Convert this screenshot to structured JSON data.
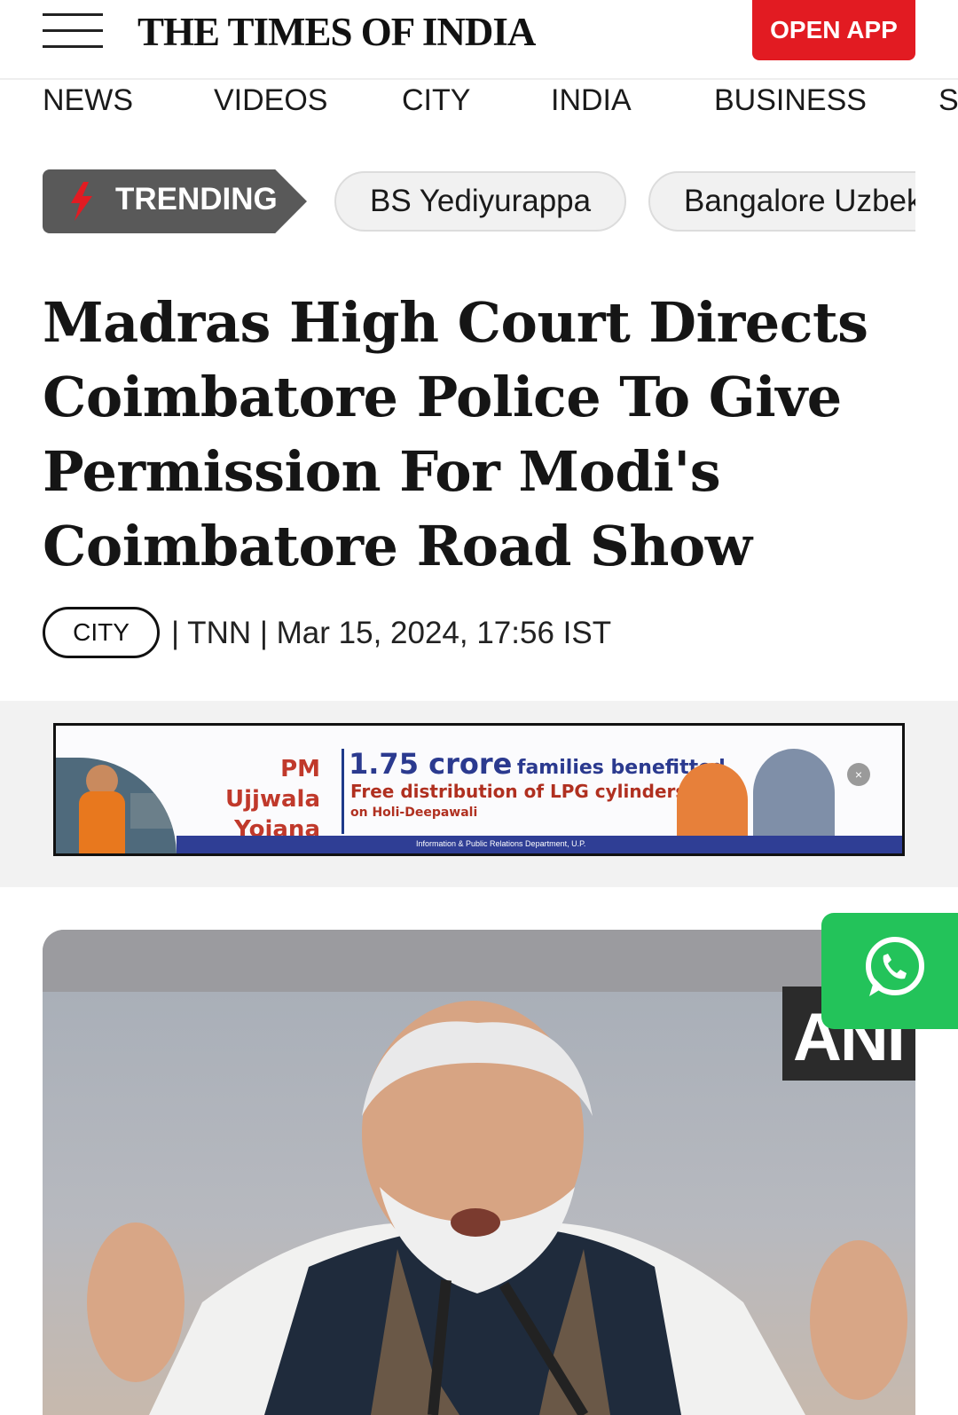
{
  "header": {
    "logo_text": "THE TIMES OF INDIA",
    "open_app_label": "OPEN APP",
    "brand_red": "#e21b22"
  },
  "nav": {
    "items": [
      "NEWS",
      "VIDEOS",
      "CITY",
      "INDIA",
      "BUSINESS",
      "S"
    ]
  },
  "trending": {
    "label": "TRENDING",
    "topics": [
      "BS Yediyurappa",
      "Bangalore Uzbek"
    ]
  },
  "article": {
    "headline": "Madras High Court Directs Coimbatore Police To Give Permission For Modi's Coimbatore Road Show",
    "category_tag": "CITY",
    "byline": "| TNN | Mar 15, 2024, 17:56 IST"
  },
  "ad": {
    "title_line1": "PM Ujjwala",
    "title_line2": "Yojana",
    "headline_big": "1.75 crore",
    "headline_small": "families benefitted",
    "line2": "Free distribution of LPG cylinders",
    "line3": "on Holi-Deepawali",
    "footer": "Information & Public Relations Department, U.P.",
    "close_glyph": "×"
  },
  "hero": {
    "watermark": "ANI"
  },
  "whatsapp": {
    "icon": "whatsapp-icon",
    "color": "#23c35a"
  }
}
